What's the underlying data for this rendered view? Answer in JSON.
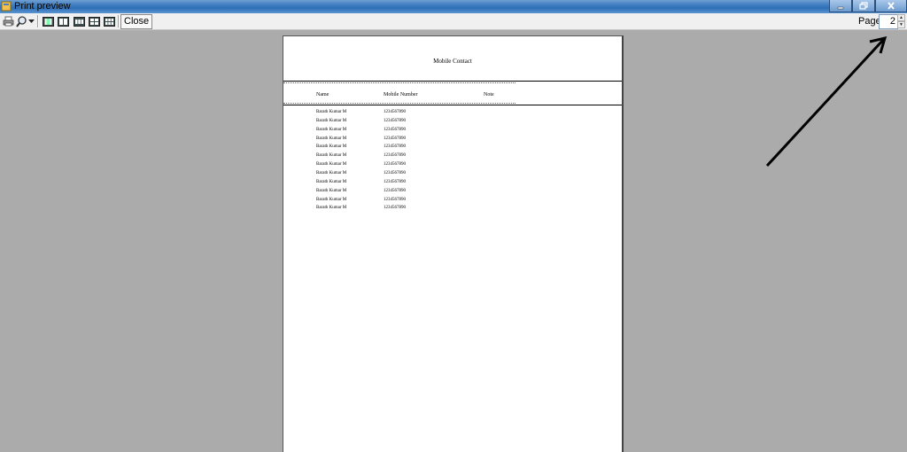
{
  "window": {
    "title": "Print preview",
    "controls": {
      "minimize_icon": "minimize-icon",
      "restore_icon": "restore-icon",
      "close_icon": "close-icon"
    }
  },
  "toolbar": {
    "buttons": [
      {
        "name": "print-button",
        "icon": "printer-icon"
      },
      {
        "name": "zoom-button",
        "icon": "magnifier-icon"
      },
      {
        "name": "one-page-button",
        "icon": "one-page-icon"
      },
      {
        "name": "two-pages-button",
        "icon": "two-pages-icon"
      },
      {
        "name": "three-pages-button",
        "icon": "three-pages-icon"
      },
      {
        "name": "four-pages-button",
        "icon": "four-pages-icon"
      },
      {
        "name": "six-pages-button",
        "icon": "six-pages-icon"
      }
    ],
    "close_label": "Close",
    "page_label": "Page",
    "page_value": "2"
  },
  "report": {
    "title": "Mobile Contact",
    "columns": [
      "Name",
      "Mobile Number",
      "Note"
    ],
    "rows": [
      {
        "name": "Barath Kumar M",
        "mobile": "1234567890"
      },
      {
        "name": "Barath Kumar M",
        "mobile": "1234567890"
      },
      {
        "name": "Barath Kumar M",
        "mobile": "1234567890"
      },
      {
        "name": "Barath Kumar M",
        "mobile": "1234567890"
      },
      {
        "name": "Barath Kumar M",
        "mobile": "1234567890"
      },
      {
        "name": "Barath Kumar M",
        "mobile": "1234567890"
      },
      {
        "name": "Barath Kumar M",
        "mobile": "1234567890"
      },
      {
        "name": "Barath Kumar M",
        "mobile": "1234567890"
      },
      {
        "name": "Barath Kumar M",
        "mobile": "1234567890"
      },
      {
        "name": "Barath Kumar M",
        "mobile": "1234567890"
      },
      {
        "name": "Barath Kumar M",
        "mobile": "1234567890"
      },
      {
        "name": "Barath Kumar M",
        "mobile": "1234567890"
      }
    ]
  },
  "annotation": {
    "icon": "arrow-annotation-icon",
    "color": "#000000"
  }
}
